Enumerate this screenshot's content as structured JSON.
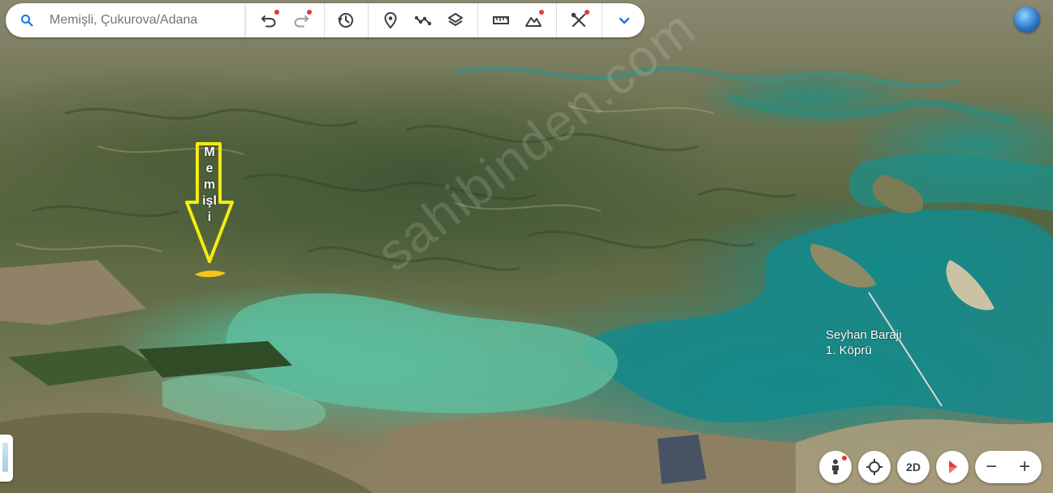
{
  "search": {
    "placeholder": "Memişli, Çukurova/Adana"
  },
  "toolbar": {
    "buttons": [
      {
        "name": "undo-icon",
        "badge": true
      },
      {
        "name": "redo-icon",
        "badge": true
      },
      {
        "name": "history-icon",
        "badge": false
      },
      {
        "name": "placemark-icon",
        "badge": false
      },
      {
        "name": "path-icon",
        "badge": false
      },
      {
        "name": "layers-icon",
        "badge": false
      },
      {
        "name": "measure-icon",
        "badge": false
      },
      {
        "name": "elevation-icon",
        "badge": true
      },
      {
        "name": "tools-icon",
        "badge": true
      },
      {
        "name": "chevron-down-icon",
        "badge": false
      }
    ]
  },
  "annotations": {
    "memisli_vertical": "Memişli",
    "seyhan_line1": "Seyhan Barajı",
    "seyhan_line2": "1. Köprü"
  },
  "watermark": "sahibinden.com",
  "controls": {
    "view_2d_label": "2D",
    "zoom_out_label": "−",
    "zoom_in_label": "+"
  },
  "colors": {
    "badge": "#e53935",
    "arrow_yellow": "#f5ea12",
    "water_teal": "#1c8f8c",
    "accent_blue": "#1a73e8"
  }
}
